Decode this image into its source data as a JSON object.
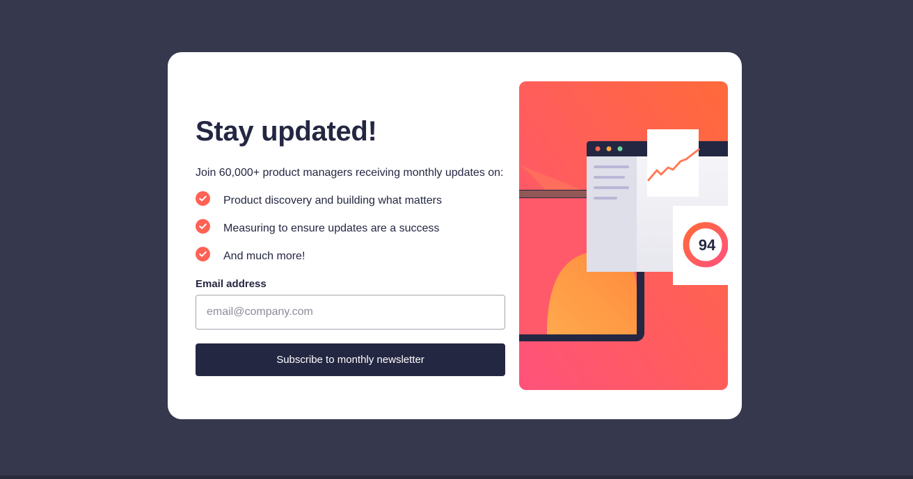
{
  "card": {
    "title": "Stay updated!",
    "intro": "Join 60,000+ product managers receiving monthly updates on:",
    "features": [
      "Product discovery and building what matters",
      "Measuring to ensure updates are a success",
      "And much more!"
    ],
    "form": {
      "email_label": "Email address",
      "email_placeholder": "email@company.com",
      "email_value": "",
      "submit_label": "Subscribe to monthly newsletter"
    },
    "illustration": {
      "score": "94"
    }
  },
  "colors": {
    "page_background": "#36384d",
    "card_background": "#ffffff",
    "text_dark": "#242742",
    "accent_tomato": "#ff6155",
    "button_background": "#242742"
  },
  "icons": {
    "feature_bullet": "check-circle-icon"
  }
}
